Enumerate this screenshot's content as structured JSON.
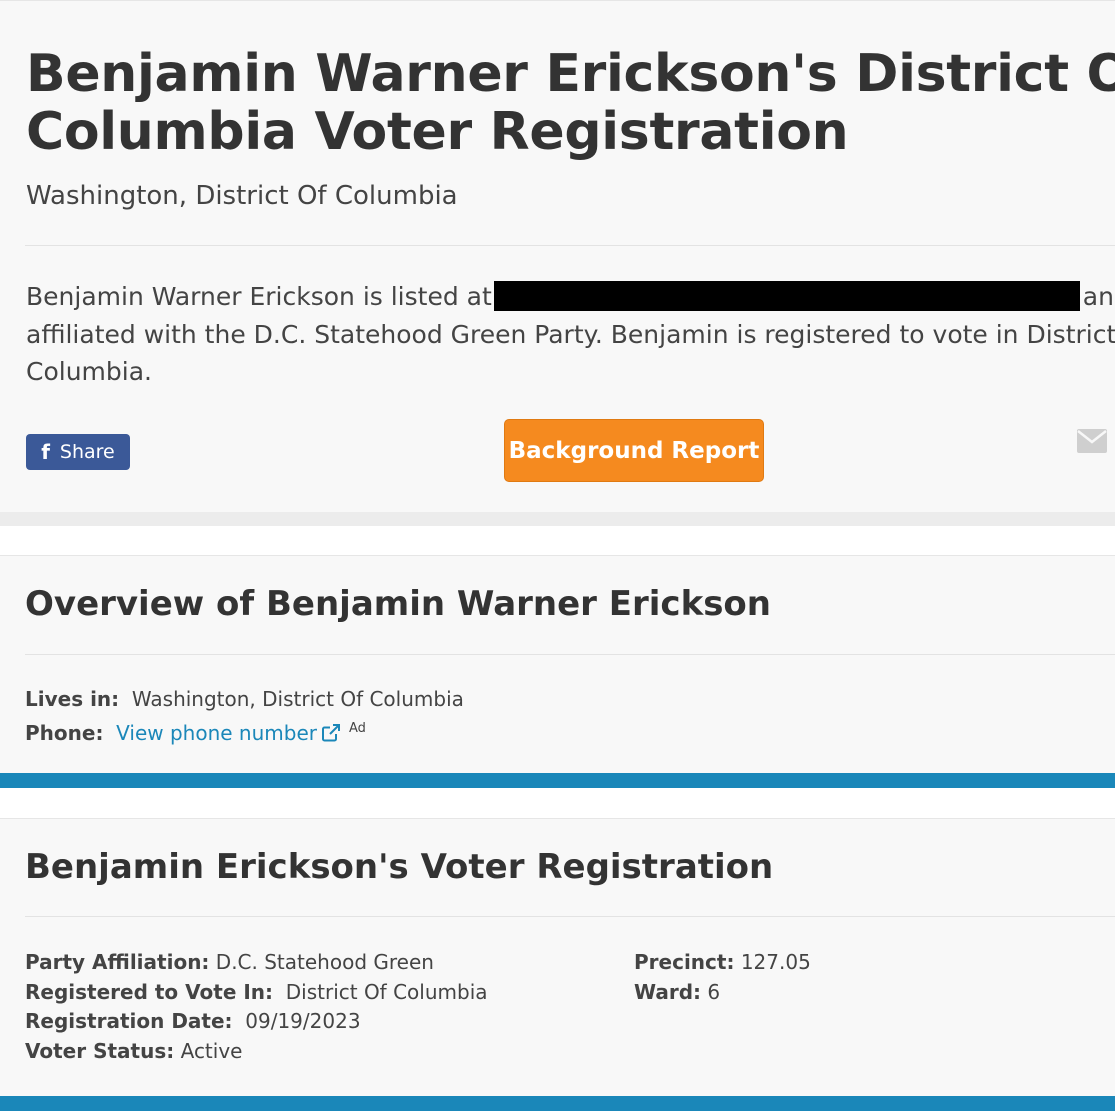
{
  "header": {
    "title_line1": "Benjamin Warner Erickson's District Of",
    "title_line2": "Columbia Voter Registration",
    "location": "Washington, District Of Columbia",
    "intro_line1_before": "Benjamin Warner Erickson is listed at",
    "intro_line1_after": "and",
    "intro_line2": "affiliated with the D.C. Statehood Green Party. Benjamin is registered to vote in District Of",
    "intro_line3": "Columbia.",
    "share_label": "Share",
    "background_report_label": "Background Report"
  },
  "overview": {
    "title": "Overview of Benjamin Warner Erickson",
    "lives_in_label": "Lives in:",
    "lives_in_value": "Washington, District Of Columbia",
    "phone_label": "Phone:",
    "phone_link": "View phone number",
    "ad_label": "Ad"
  },
  "registration": {
    "title": "Benjamin Erickson's Voter Registration",
    "party_label": "Party Affiliation:",
    "party_value": "D.C. Statehood Green",
    "registered_label": "Registered to Vote In:",
    "registered_value": "District Of Columbia",
    "date_label": "Registration Date:",
    "date_value": "09/19/2023",
    "status_label": "Voter Status:",
    "status_value": "Active",
    "precinct_label": "Precinct:",
    "precinct_value": "127.05",
    "ward_label": "Ward:",
    "ward_value": "6"
  },
  "colors": {
    "accent_blue": "#1a87b9",
    "report_orange": "#f58a1f",
    "facebook_blue": "#3b5998"
  },
  "icons": [
    "facebook-icon",
    "mail-icon",
    "external-link-icon"
  ]
}
